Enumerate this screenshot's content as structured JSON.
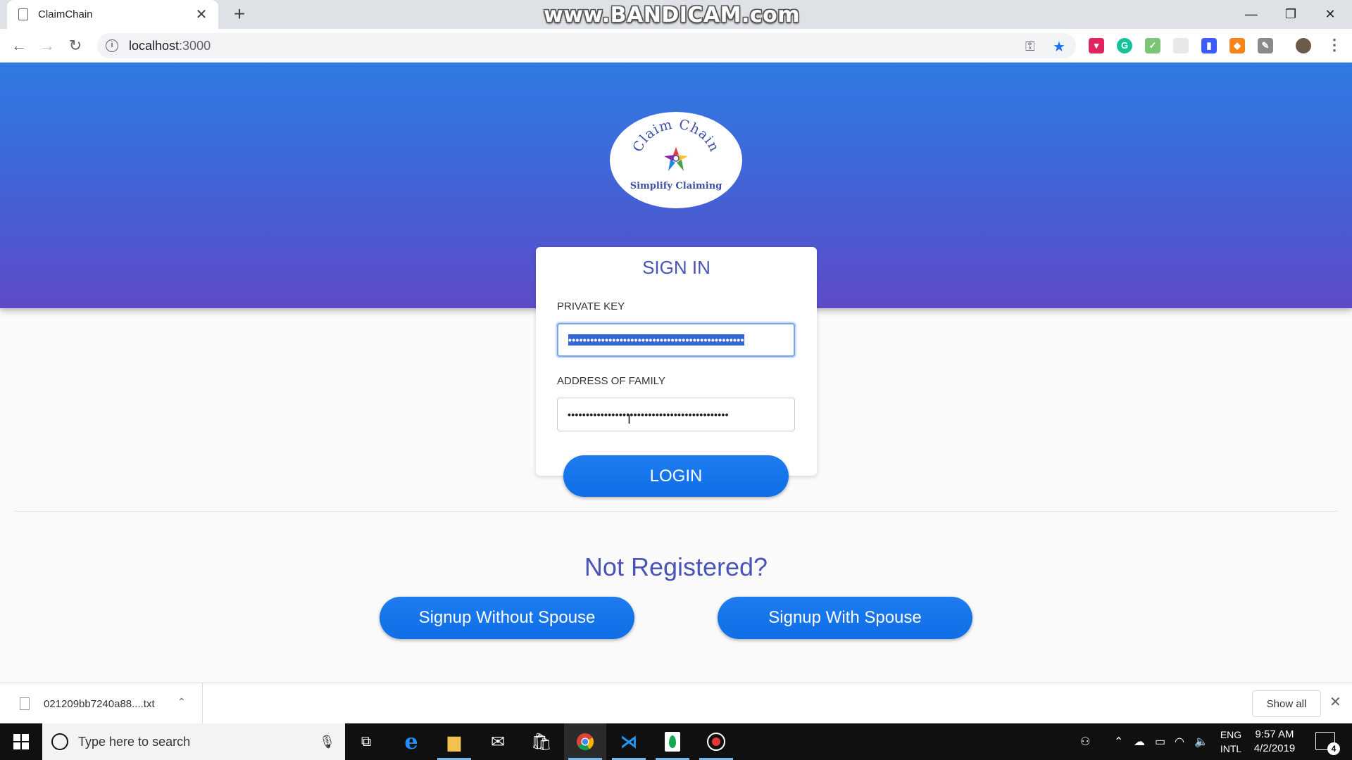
{
  "browser": {
    "tab_title": "ClaimChain",
    "tab_close": "✕",
    "new_tab": "+",
    "watermark": "www.BANDICAM.com",
    "url_host": "localhost",
    "url_port": ":3000",
    "window_controls": {
      "minimize": "—",
      "restore": "❐",
      "close": "✕"
    }
  },
  "logo": {
    "name": "Claim Chain",
    "tagline": "Simplify Claiming"
  },
  "signin": {
    "heading": "SIGN IN",
    "private_key_label": "PRIVATE KEY",
    "private_key_value": "••••••••••••••••••••••••••••••••••••••••••••••••",
    "family_address_label": "ADDRESS OF FAMILY",
    "family_address_value": "••••••••••••••••••••••••••••••••••••••••••••",
    "login_label": "LOGIN"
  },
  "register": {
    "prompt": "Not Registered?",
    "signup_without_spouse": "Signup Without Spouse",
    "signup_with_spouse": "Signup With Spouse"
  },
  "download_shelf": {
    "file_name": "021209bb7240a88....txt",
    "show_all": "Show all"
  },
  "taskbar": {
    "search_placeholder": "Type here to search",
    "lang_top": "ENG",
    "lang_bottom": "INTL",
    "time": "9:57 AM",
    "date": "4/2/2019",
    "notification_count": "4"
  }
}
